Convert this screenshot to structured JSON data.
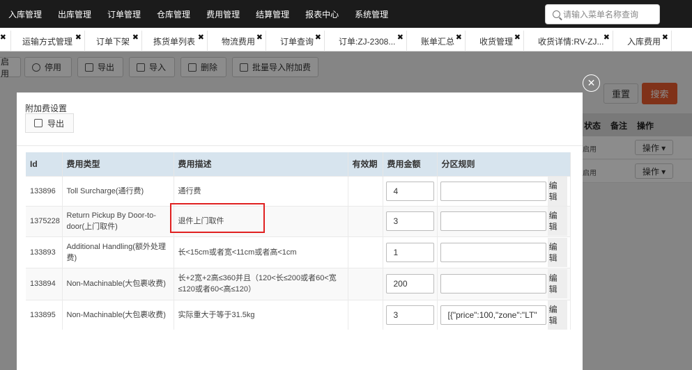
{
  "nav": {
    "items": [
      "入库管理",
      "出库管理",
      "订单管理",
      "仓库管理",
      "费用管理",
      "结算管理",
      "报表中心",
      "系统管理"
    ],
    "search_placeholder": "请输入菜单名称查询"
  },
  "tabs": [
    {
      "label": "运输方式管理"
    },
    {
      "label": "订单下架"
    },
    {
      "label": "拣货单列表"
    },
    {
      "label": "物流费用"
    },
    {
      "label": "订单查询"
    },
    {
      "label": "订单:ZJ-2308..."
    },
    {
      "label": "账单汇总"
    },
    {
      "label": "收货管理"
    },
    {
      "label": "收货详情:RV-ZJ..."
    },
    {
      "label": "入库费用"
    }
  ],
  "toolbar": {
    "enable": "启用",
    "disable": "停用",
    "export": "导出",
    "import": "导入",
    "delete": "删除",
    "batch_import": "批量导入附加费"
  },
  "background": {
    "reset": "重置",
    "search": "搜索",
    "headers": [
      "状态",
      "备注",
      "操作"
    ],
    "rows": [
      {
        "status": "启用",
        "op": "操作 ▾"
      },
      {
        "status": "启用",
        "op": "操作 ▾"
      }
    ]
  },
  "modal": {
    "title": "附加费设置",
    "export": "导出",
    "columns": [
      "Id",
      "费用类型",
      "费用描述",
      "有效期",
      "费用金额",
      "分区规则"
    ],
    "edit_label": "编辑",
    "rows": [
      {
        "id": "133896",
        "type": "Toll Surcharge(通行费)",
        "desc": "通行费",
        "validity": "",
        "amount": "4",
        "rule": ""
      },
      {
        "id": "1375228",
        "type": "Return Pickup By Door-to-door(上门取件)",
        "desc": "退件上门取件",
        "validity": "",
        "amount": "3",
        "rule": ""
      },
      {
        "id": "133893",
        "type": "Additional Handling(额外处理费)",
        "desc": "长<15cm或者宽<11cm或者高<1cm",
        "validity": "",
        "amount": "1",
        "rule": ""
      },
      {
        "id": "133894",
        "type": "Non-Machinable(大包裹收费)",
        "desc": "长+2宽+2高≤360并且（120<长≤200或者60<宽≤120或者60<高≤120）",
        "validity": "",
        "amount": "200",
        "rule": ""
      },
      {
        "id": "133895",
        "type": "Non-Machinable(大包裹收费)",
        "desc": "实际重大于等于31.5kg",
        "validity": "",
        "amount": "3",
        "rule": "[{\"price\":100,\"zone\":\"LT\""
      }
    ]
  }
}
